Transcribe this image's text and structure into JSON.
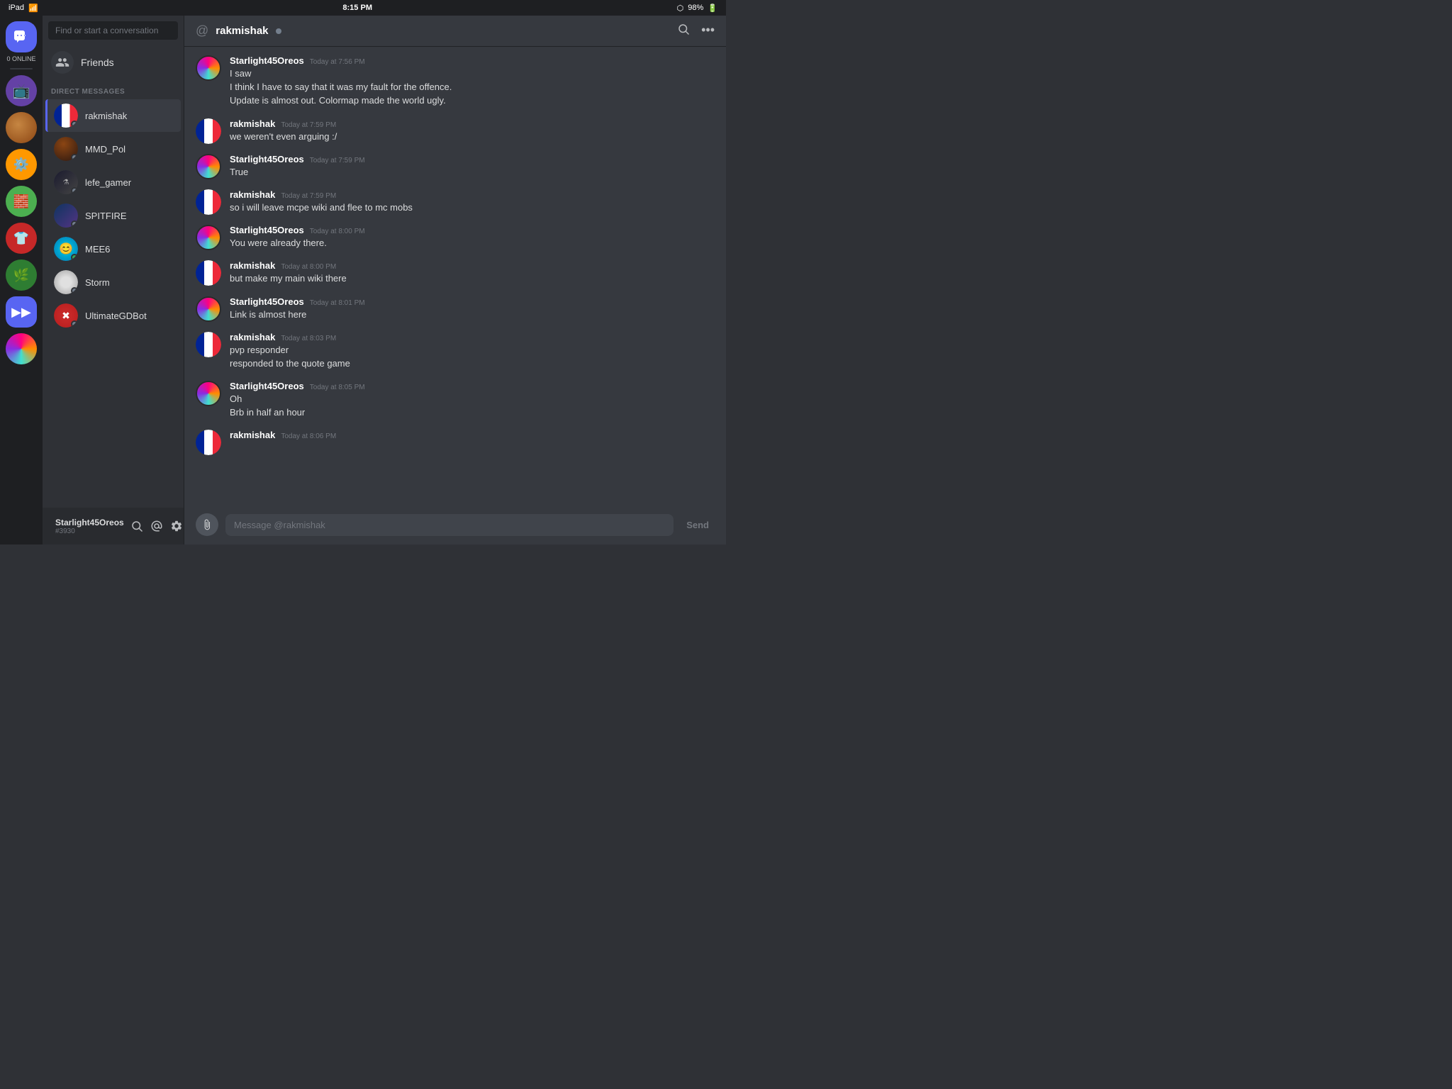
{
  "statusBar": {
    "left": "iPad",
    "time": "8:15 PM",
    "battery": "98%"
  },
  "searchBar": {
    "placeholder": "Find or start a conversation"
  },
  "friends": {
    "label": "Friends"
  },
  "dmSection": {
    "header": "DIRECT MESSAGES"
  },
  "dmList": [
    {
      "id": "rakmishak",
      "name": "rakmishak",
      "status": "offline",
      "active": true
    },
    {
      "id": "mmd_pol",
      "name": "MMD_Pol",
      "status": "offline",
      "active": false
    },
    {
      "id": "lefe_gamer",
      "name": "lefe_gamer",
      "status": "offline",
      "active": false
    },
    {
      "id": "spitfire",
      "name": "SPITFIRE",
      "status": "offline",
      "active": false
    },
    {
      "id": "mee6",
      "name": "MEE6",
      "status": "online",
      "active": false
    },
    {
      "id": "storm",
      "name": "Storm",
      "status": "offline",
      "active": false
    },
    {
      "id": "ultimategdbot",
      "name": "UltimateGDBot",
      "status": "offline",
      "active": false
    }
  ],
  "currentUser": {
    "name": "Starlight45Oreos",
    "tag": "#3930"
  },
  "chatHeader": {
    "atSign": "@",
    "name": "rakmishak",
    "status": "offline"
  },
  "messages": [
    {
      "author": "Starlight45Oreos",
      "timestamp": "Today at 7:56 PM",
      "lines": [
        "I saw",
        "I think I have to say that it was my fault for the offence.",
        "Update is almost out. Colormap made the world ugly."
      ],
      "type": "starlight"
    },
    {
      "author": "rakmishak",
      "timestamp": "Today at 7:59 PM",
      "lines": [
        "we weren't even arguing :/"
      ],
      "type": "rakmishak"
    },
    {
      "author": "Starlight45Oreos",
      "timestamp": "Today at 7:59 PM",
      "lines": [
        "True"
      ],
      "type": "starlight"
    },
    {
      "author": "rakmishak",
      "timestamp": "Today at 7:59 PM",
      "lines": [
        "so i will leave mcpe wiki and flee to mc mobs"
      ],
      "type": "rakmishak"
    },
    {
      "author": "Starlight45Oreos",
      "timestamp": "Today at 8:00 PM",
      "lines": [
        "You were already there."
      ],
      "type": "starlight"
    },
    {
      "author": "rakmishak",
      "timestamp": "Today at 8:00 PM",
      "lines": [
        "but make my main wiki there"
      ],
      "type": "rakmishak"
    },
    {
      "author": "Starlight45Oreos",
      "timestamp": "Today at 8:01 PM",
      "lines": [
        "Link is almost here"
      ],
      "type": "starlight"
    },
    {
      "author": "rakmishak",
      "timestamp": "Today at 8:03 PM",
      "lines": [
        "pvp responder",
        "responded to the quote game"
      ],
      "type": "rakmishak"
    },
    {
      "author": "Starlight45Oreos",
      "timestamp": "Today at 8:05 PM",
      "lines": [
        "Oh",
        "Brb in half an hour"
      ],
      "type": "starlight"
    },
    {
      "author": "rakmishak",
      "timestamp": "Today at 8:06 PM",
      "lines": [],
      "type": "rakmishak"
    }
  ],
  "inputBar": {
    "placeholder": "Message @rakmishak",
    "sendLabel": "Send"
  },
  "onlineCount": "0 ONLINE"
}
